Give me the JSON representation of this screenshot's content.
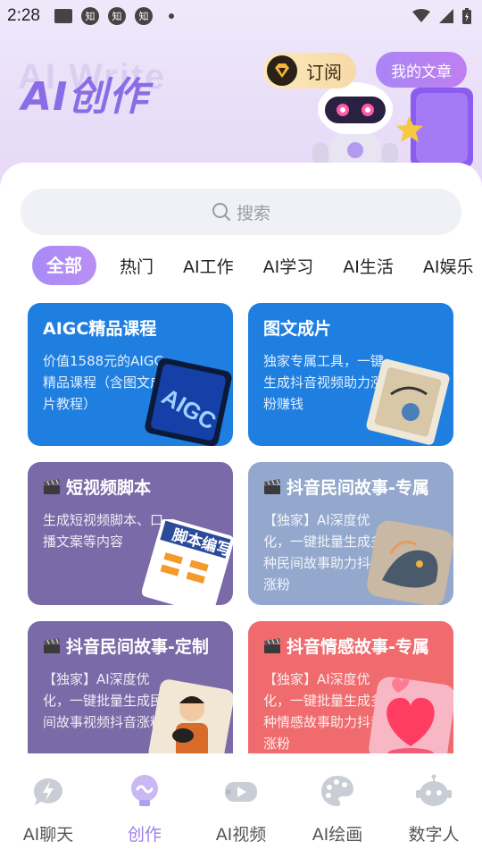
{
  "status_bar": {
    "time": "2:28",
    "notif_glyph": "知"
  },
  "header": {
    "brand_title": "AI创作",
    "brand_ghost": "AI Write",
    "subscribe_label": "订阅",
    "my_articles_label": "我的文章"
  },
  "search": {
    "placeholder": "搜索"
  },
  "tabs": [
    {
      "label": "全部",
      "active": true
    },
    {
      "label": "热门",
      "active": false
    },
    {
      "label": "AI工作",
      "active": false
    },
    {
      "label": "AI学习",
      "active": false
    },
    {
      "label": "AI生活",
      "active": false
    },
    {
      "label": "AI娱乐",
      "active": false
    }
  ],
  "cards": [
    {
      "title": "AIGC精品课程",
      "desc": "价值1588元的AIGC精品课程（含图文成片教程）",
      "color": "#1e7fe0",
      "icon": "none"
    },
    {
      "title": "图文成片",
      "desc": "独家专属工具，一键生成抖音视频助力涨粉赚钱",
      "color": "#1e7fe0",
      "icon": "none"
    },
    {
      "title": "短视频脚本",
      "desc": "生成短视频脚本、口播文案等内容",
      "color": "#7a6aa8",
      "icon": "clapperboard-icon"
    },
    {
      "title": "抖音民间故事-专属",
      "desc": "【独家】AI深度优化，一键批量生成多种民间故事助力抖音涨粉",
      "color": "#93a8cc",
      "icon": "clapperboard-icon"
    },
    {
      "title": "抖音民间故事-定制",
      "desc": "【独家】AI深度优化，一键批量生成民间故事视频抖音涨粉",
      "color": "#7a6aa8",
      "icon": "clapperboard-icon"
    },
    {
      "title": "抖音情感故事-专属",
      "desc": "【独家】AI深度优化，一键批量生成多种情感故事助力抖音涨粉",
      "color": "#ef6b6e",
      "icon": "clapperboard-icon"
    }
  ],
  "card_art_text": {
    "aigc": "AIGC",
    "script": "脚本编写"
  },
  "bottom_nav": [
    {
      "label": "AI聊天",
      "icon": "chat-bolt-icon",
      "active": false
    },
    {
      "label": "创作",
      "icon": "create-bulb-icon",
      "active": true
    },
    {
      "label": "AI视频",
      "icon": "video-camera-icon",
      "active": false
    },
    {
      "label": "AI绘画",
      "icon": "palette-icon",
      "active": false
    },
    {
      "label": "数字人",
      "icon": "robot-head-icon",
      "active": false
    }
  ],
  "colors": {
    "accent": "#9a7fe8",
    "active_tab": "#a98af6",
    "blue_card": "#1e7fe0",
    "purple_card": "#7a6aa8",
    "slate_card": "#93a8cc",
    "red_card": "#ef6b6e"
  }
}
